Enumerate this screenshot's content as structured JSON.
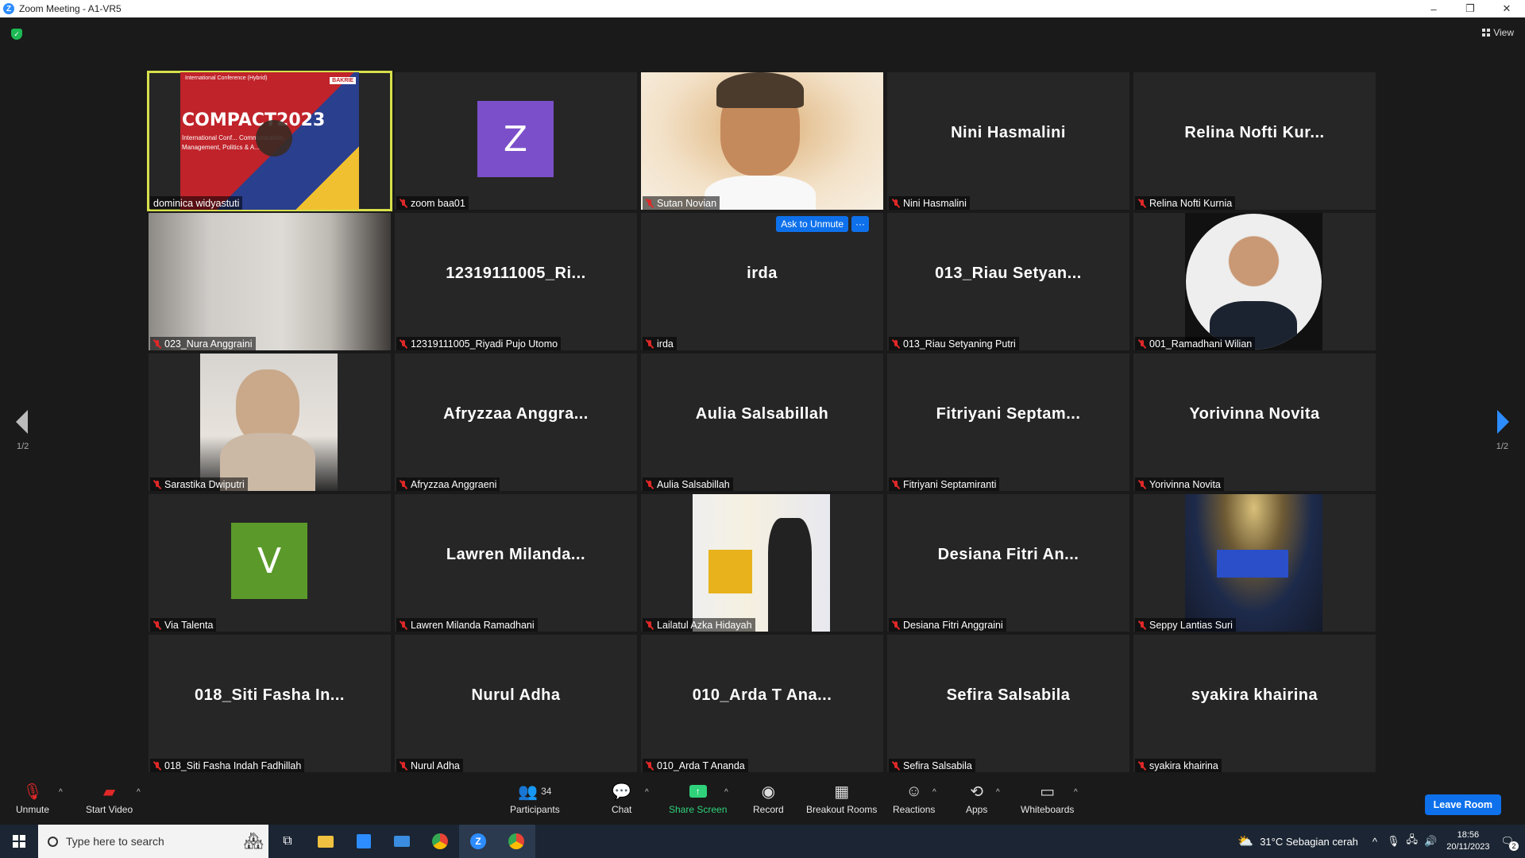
{
  "window": {
    "title": "Zoom Meeting - A1-VR5",
    "minimize": "–",
    "maximize": "❐",
    "close": "✕"
  },
  "view_button": "View",
  "tiles": [
    {
      "big": "",
      "label": "dominica widyastuti",
      "muted": false,
      "kind": "video-slide",
      "active": true
    },
    {
      "big": "",
      "label": "zoom baa01",
      "muted": true,
      "kind": "letter",
      "letter": "Z",
      "color": "#7b4fc9"
    },
    {
      "big": "",
      "label": "Sutan Novian",
      "muted": true,
      "kind": "video-person"
    },
    {
      "big": "Nini Hasmalini",
      "label": "Nini Hasmalini",
      "muted": true
    },
    {
      "big": "Relina  Nofti  Kur...",
      "label": "Relina Nofti Kurnia",
      "muted": true
    },
    {
      "big": "",
      "label": "023_Nura Anggraini",
      "muted": true,
      "kind": "video-room"
    },
    {
      "big": "12319111005_Ri...",
      "label": "12319111005_Riyadi Pujo Utomo",
      "muted": true
    },
    {
      "big": "irda",
      "label": "irda",
      "muted": true,
      "ask": true
    },
    {
      "big": "013_Riau  Setyan...",
      "label": "013_Riau Setyaning Putri",
      "muted": true
    },
    {
      "big": "",
      "label": "001_Ramadhani Wilian",
      "muted": true,
      "kind": "photo-circle"
    },
    {
      "big": "",
      "label": "Sarastika Dwiputri",
      "muted": true,
      "kind": "photo-woman"
    },
    {
      "big": "Afryzzaa  Anggra...",
      "label": "Afryzzaa Anggraeni",
      "muted": true
    },
    {
      "big": "Aulia  Salsabillah",
      "label": "Aulia Salsabillah",
      "muted": true
    },
    {
      "big": "Fitriyani  Septam...",
      "label": "Fitriyani Septamiranti",
      "muted": true
    },
    {
      "big": "Yorivinna  Novita",
      "label": "Yorivinna Novita",
      "muted": true
    },
    {
      "big": "",
      "label": "Via Talenta",
      "muted": true,
      "kind": "letter",
      "letter": "V",
      "color": "#5b9a2a"
    },
    {
      "big": "Lawren  Milanda...",
      "label": "Lawren Milanda Ramadhani",
      "muted": true
    },
    {
      "big": "",
      "label": "Lailatul Azka Hidayah",
      "muted": true,
      "kind": "photo-art"
    },
    {
      "big": "Desiana  Fitri  An...",
      "label": "Desiana Fitri Anggraini",
      "muted": true
    },
    {
      "big": "",
      "label": "Seppy Lantias Suri",
      "muted": true,
      "kind": "photo-hall"
    },
    {
      "big": "018_Siti  Fasha  In...",
      "label": "018_Siti Fasha Indah Fadhillah",
      "muted": true
    },
    {
      "big": "Nurul  Adha",
      "label": "Nurul Adha",
      "muted": true
    },
    {
      "big": "010_Arda  T  Ana...",
      "label": "010_Arda T Ananda",
      "muted": true
    },
    {
      "big": "Sefira  Salsabila",
      "label": "Sefira Salsabila",
      "muted": true
    },
    {
      "big": "syakira  khairina",
      "label": "syakira khairina",
      "muted": true
    }
  ],
  "ask_to_unmute": "Ask to Unmute",
  "more": "···",
  "pagination": {
    "left": "1/2",
    "right": "1/2"
  },
  "slide": {
    "title": "COMPACT2023",
    "brand": "BAKRIE",
    "line1": "International Conference (Hybrid)",
    "line2": "International Conf... Communication,",
    "line3": "Management, Politics & A..."
  },
  "toolbar": {
    "unmute": "Unmute",
    "start_video": "Start Video",
    "participants": "Participants",
    "participants_count": "34",
    "chat": "Chat",
    "share_screen": "Share Screen",
    "record": "Record",
    "breakout": "Breakout Rooms",
    "reactions": "Reactions",
    "apps": "Apps",
    "whiteboards": "Whiteboards",
    "leave": "Leave Room"
  },
  "taskbar": {
    "search_placeholder": "Type here to search",
    "weather": "31°C  Sebagian cerah",
    "time": "18:56",
    "date": "20/11/2023",
    "notif_count": "2"
  }
}
